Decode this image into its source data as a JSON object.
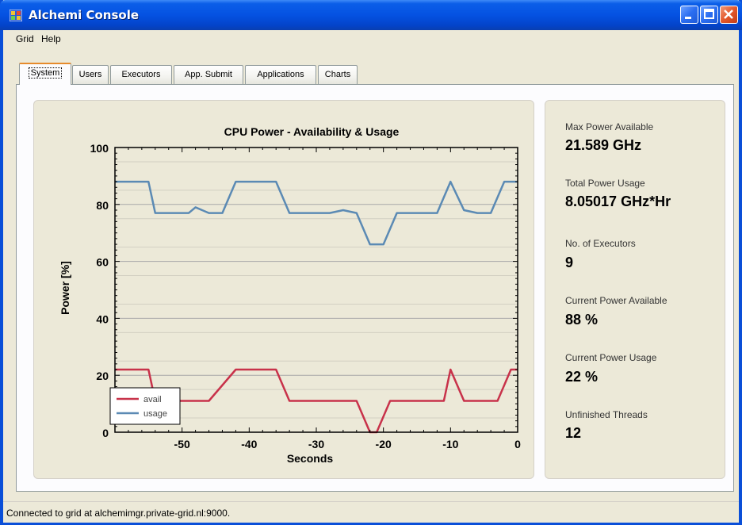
{
  "window": {
    "title": "Alchemi Console",
    "titlebar_color": "#0552e2",
    "close_color": "#e4572b"
  },
  "menu": {
    "items": [
      "Grid",
      "Help"
    ]
  },
  "tabs": [
    "System",
    "Users",
    "Executors",
    "App. Submit",
    "Applications",
    "Charts"
  ],
  "active_tab": "System",
  "chart_data": {
    "type": "line",
    "title": "CPU Power - Availability & Usage",
    "xlabel": "Seconds",
    "ylabel": "Power [%]",
    "xlim": [
      -60,
      0
    ],
    "ylim": [
      0,
      100
    ],
    "x_ticks": [
      -50,
      -40,
      -30,
      -20,
      -10,
      0
    ],
    "y_ticks": [
      0,
      20,
      40,
      60,
      80,
      100
    ],
    "grid": true,
    "legend_position": "bottom-left",
    "series": [
      {
        "name": "avail",
        "color": "#c8324a",
        "x": [
          -60,
          -55,
          -54,
          -52,
          -48,
          -46,
          -42,
          -40,
          -36,
          -34,
          -30,
          -26,
          -24,
          -22,
          -21,
          -19,
          -17,
          -15,
          -11,
          -10,
          -8,
          -6,
          -4,
          -3,
          -1,
          0
        ],
        "y": [
          22,
          22,
          11,
          11,
          11,
          11,
          22,
          22,
          22,
          11,
          11,
          11,
          11,
          0,
          0,
          11,
          11,
          11,
          11,
          22,
          11,
          11,
          11,
          11,
          22,
          22
        ]
      },
      {
        "name": "usage",
        "color": "#5b8ab4",
        "x": [
          -60,
          -55,
          -54,
          -52,
          -49,
          -48,
          -46,
          -44,
          -42,
          -40,
          -36,
          -34,
          -30,
          -28,
          -26,
          -24,
          -22,
          -20,
          -18,
          -16,
          -12,
          -10,
          -8,
          -6,
          -4,
          -2,
          0
        ],
        "y": [
          88,
          88,
          77,
          77,
          77,
          79,
          77,
          77,
          88,
          88,
          88,
          77,
          77,
          77,
          78,
          77,
          66,
          66,
          77,
          77,
          77,
          88,
          78,
          77,
          77,
          88,
          88
        ]
      }
    ]
  },
  "stats": [
    {
      "label": "Max Power Available",
      "value": "21.589 GHz"
    },
    {
      "label": "Total Power Usage",
      "value": "8.05017 GHz*Hr"
    },
    {
      "label": "No. of Executors",
      "value": "9"
    },
    {
      "label": "Current Power Available",
      "value": "88 %"
    },
    {
      "label": "Current Power Usage",
      "value": "22 %"
    },
    {
      "label": "Unfinished Threads",
      "value": "12"
    }
  ],
  "status": {
    "text": "Connected to grid at alchemimgr.private-grid.nl:9000."
  }
}
